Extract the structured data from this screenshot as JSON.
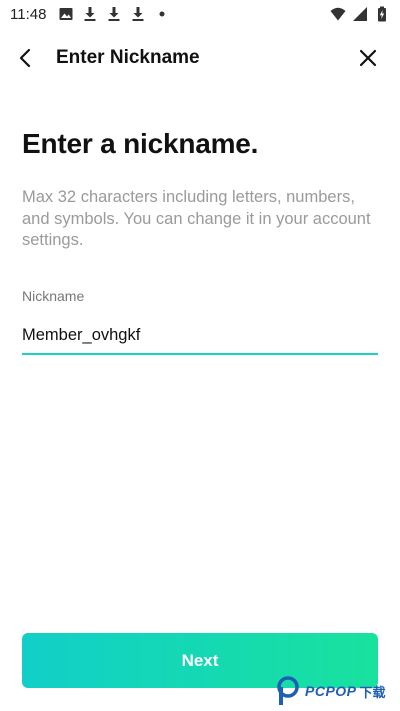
{
  "status_bar": {
    "time": "11:48",
    "left_icons": [
      "image-icon",
      "download-icon",
      "download-icon",
      "download-icon",
      "dot-icon"
    ],
    "right_icons": [
      "wifi-icon",
      "signal-icon",
      "battery-icon"
    ]
  },
  "app_bar": {
    "title": "Enter Nickname",
    "back_icon": "chevron-left-icon",
    "close_icon": "close-icon"
  },
  "content": {
    "heading": "Enter a nickname.",
    "description": "Max 32 characters including letters, numbers, and symbols. You can change it in your account settings."
  },
  "nickname_field": {
    "label": "Nickname",
    "value": "Member_ovhgkf",
    "underline_color": "#19d2c1"
  },
  "next_button": {
    "label": "Next",
    "gradient_start": "#11cfc8",
    "gradient_end": "#18e29e"
  },
  "watermark": {
    "text": "PCPOP",
    "text_cn": "下载"
  }
}
